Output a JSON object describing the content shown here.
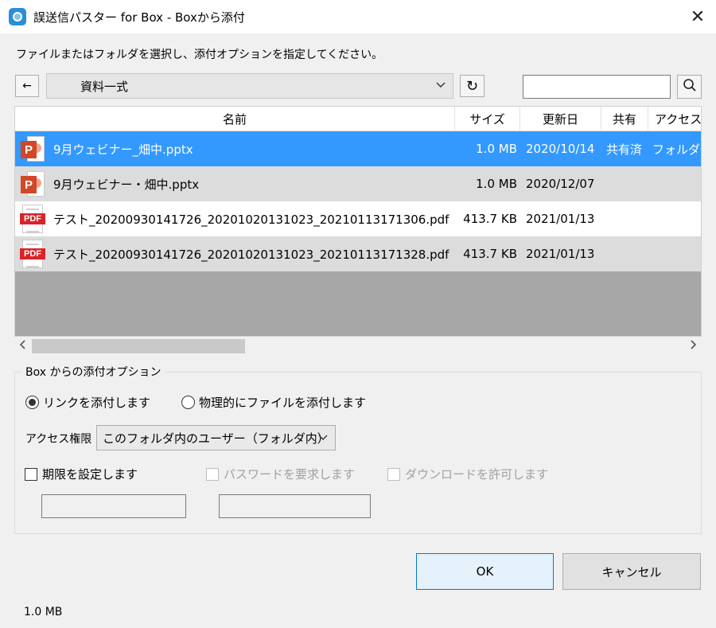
{
  "window": {
    "title": "誤送信パスター for Box - Boxから添付",
    "close_symbol": "✕"
  },
  "instruction": "ファイルまたはフォルダを選択し、添付オプションを指定してください。",
  "toolbar": {
    "back_symbol": "←",
    "folder": "資料一式",
    "refresh_symbol": "↻",
    "search_value": ""
  },
  "file_list": {
    "columns": [
      "名前",
      "サイズ",
      "更新日",
      "共有",
      "アクセス権"
    ],
    "rows": [
      {
        "type": "pptx",
        "name": "9月ウェビナー_畑中.pptx",
        "size": "1.0 MB",
        "date": "2020/10/14",
        "shared": "共有済",
        "access": "フォルダ内"
      },
      {
        "type": "pptx",
        "name": "9月ウェビナー・畑中.pptx",
        "size": "1.0 MB",
        "date": "2020/12/07",
        "shared": "",
        "access": ""
      },
      {
        "type": "pdf",
        "name": "テスト_20200930141726_20201020131023_20210113171306.pdf",
        "size": "413.7 KB",
        "date": "2021/01/13",
        "shared": "",
        "access": ""
      },
      {
        "type": "pdf",
        "name": "テスト_20200930141726_20201020131023_20210113171328.pdf",
        "size": "413.7 KB",
        "date": "2021/01/13",
        "shared": "",
        "access": ""
      }
    ],
    "selected_row": 0,
    "icon_labels": {
      "pptx": "P",
      "pdf": "PDF"
    }
  },
  "options": {
    "legend": "Box からの添付オプション",
    "radio_link": "リンクを添付します",
    "radio_physical": "物理的にファイルを添付します",
    "selected_radio": "link",
    "access_label": "アクセス権限",
    "access_value": "このフォルダ内のユーザー（フォルダ内）",
    "expiry_label": "期限を設定します",
    "password_label": "パスワードを要求します",
    "download_label": "ダウンロードを許可します"
  },
  "buttons": {
    "ok": "OK",
    "cancel": "キャンセル"
  },
  "status_bar": {
    "text": "1.0 MB"
  },
  "colors": {
    "selection": "#3399ff",
    "accent": "#0078d7",
    "ppt": "#d24726",
    "pdf": "#d9242a"
  }
}
